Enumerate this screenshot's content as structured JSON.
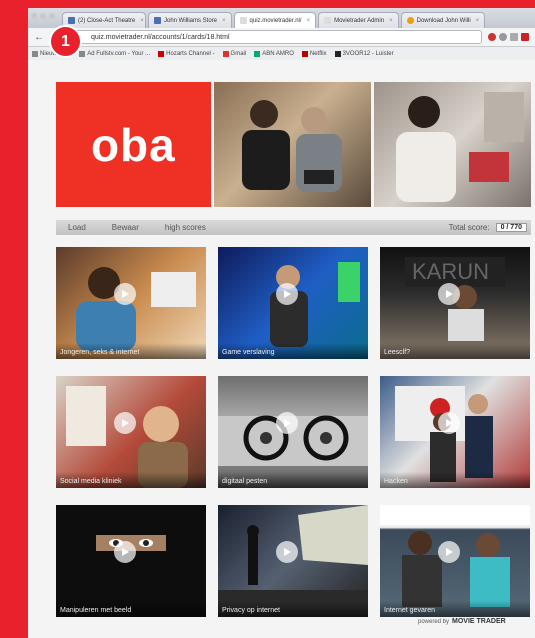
{
  "browser": {
    "tabs": [
      {
        "label": "(2) Close-Act Theatre"
      },
      {
        "label": "John Williams Store"
      },
      {
        "label": "quiz.movietrader.nl/"
      },
      {
        "label": "Movietrader Admin"
      },
      {
        "label": "Download John Willi"
      }
    ],
    "url": "quiz.movietrader.nl/accounts/1/cards/18.html",
    "bookmarks": [
      "Nieuwe Tab",
      "Ad Fullstv.com - Your ...",
      "Hozarts Channel -",
      "Gmail",
      "ABN AMRO",
      "Netflix",
      "3VOOR12 - Luister"
    ]
  },
  "badge": {
    "number": "1"
  },
  "header": {
    "logo_text": "oba"
  },
  "menubar": {
    "items": [
      "Load",
      "Bewaar",
      "high scores"
    ],
    "total_label": "Total score:",
    "total_value": "0 / 770"
  },
  "videos": [
    {
      "caption": "Jongeren, seks & internet"
    },
    {
      "caption": "Game verslaving"
    },
    {
      "caption": "Leesclf?"
    },
    {
      "caption": "Social media kliniek"
    },
    {
      "caption": "digitaal pesten"
    },
    {
      "caption": "Hacken"
    },
    {
      "caption": "Manipuleren met beeld"
    },
    {
      "caption": "Privacy op internet"
    },
    {
      "caption": "Internet gevaren"
    }
  ],
  "footer": {
    "powered_by": "powered by",
    "brand": "MOVIE TRADER"
  },
  "colors": {
    "brand_red": "#e8212c",
    "logo_red": "#ee3124"
  }
}
